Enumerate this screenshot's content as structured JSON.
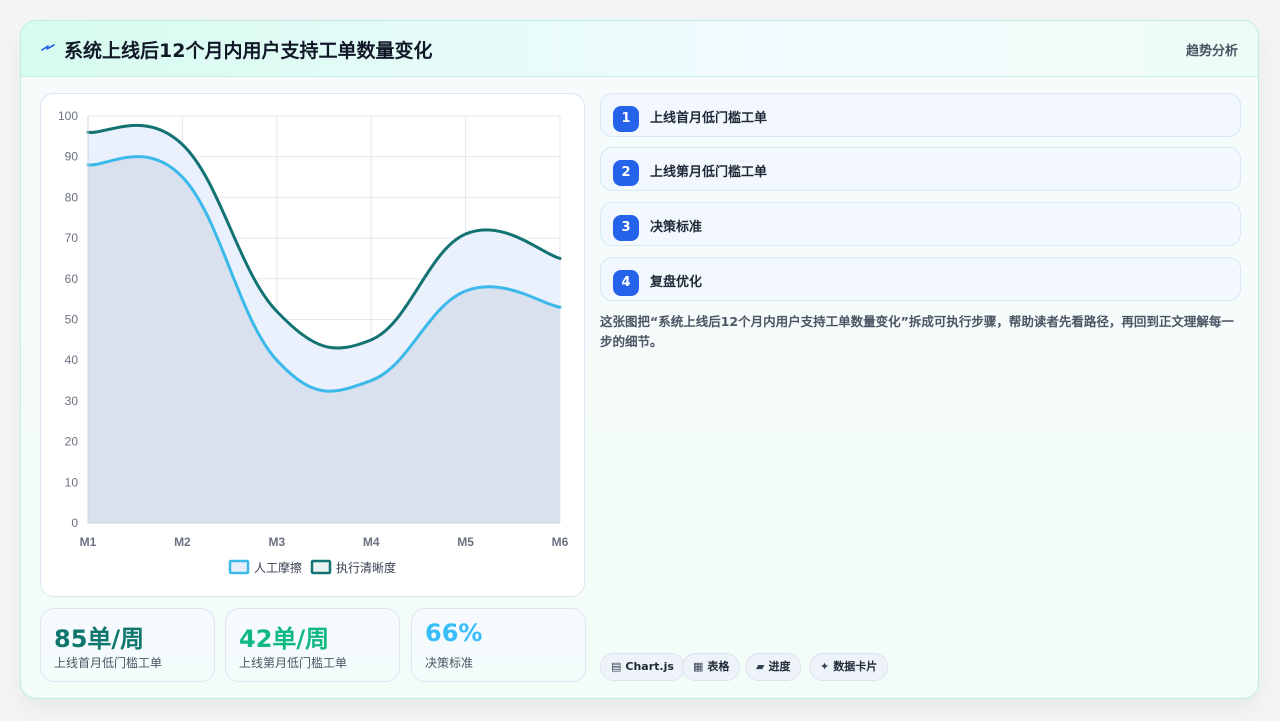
{
  "header": {
    "icon": "lightning-icon",
    "title": "系统上线后12个月内用户支持工单数量变化",
    "tag": "趋势分析"
  },
  "chart_data": {
    "type": "line",
    "categories": [
      "M1",
      "M2",
      "M3",
      "M4",
      "M5",
      "M6"
    ],
    "ylim": [
      0,
      100
    ],
    "yticks": [
      0,
      10,
      20,
      30,
      40,
      50,
      60,
      70,
      80,
      90,
      100
    ],
    "series": [
      {
        "name": "人工摩擦",
        "values": [
          88,
          85,
          40,
          35,
          57,
          53
        ],
        "color": "#3bb9ea",
        "fill": true
      },
      {
        "name": "执行清晰度",
        "values": [
          96,
          93,
          52,
          45,
          71,
          65
        ],
        "color": "#137373",
        "fill": true
      }
    ],
    "legend": "bottom",
    "grid": true
  },
  "stats": [
    {
      "value": "85单/周",
      "label": "上线首月低门槛工单",
      "color": "#0f766e"
    },
    {
      "value": "42单/周",
      "label": "上线第月低门槛工单",
      "color": "#10b981"
    },
    {
      "value": "66%",
      "label": "决策标准",
      "color": "#38bdf8"
    }
  ],
  "steps": [
    {
      "num": "1",
      "label": "上线首月低门槛工单"
    },
    {
      "num": "2",
      "label": "上线第月低门槛工单"
    },
    {
      "num": "3",
      "label": "决策标准"
    },
    {
      "num": "4",
      "label": "复盘优化"
    }
  ],
  "description": "这张图把“系统上线后12个月内用户支持工单数量变化”拆成可执行步骤，帮助读者先看路径，再回到正文理解每一步的细节。",
  "chips": [
    {
      "icon": "▤",
      "label": "Chart.js"
    },
    {
      "icon": "▦",
      "label": "表格"
    },
    {
      "icon": "▰",
      "label": "进度"
    },
    {
      "icon": "✦",
      "label": "数据卡片"
    }
  ]
}
